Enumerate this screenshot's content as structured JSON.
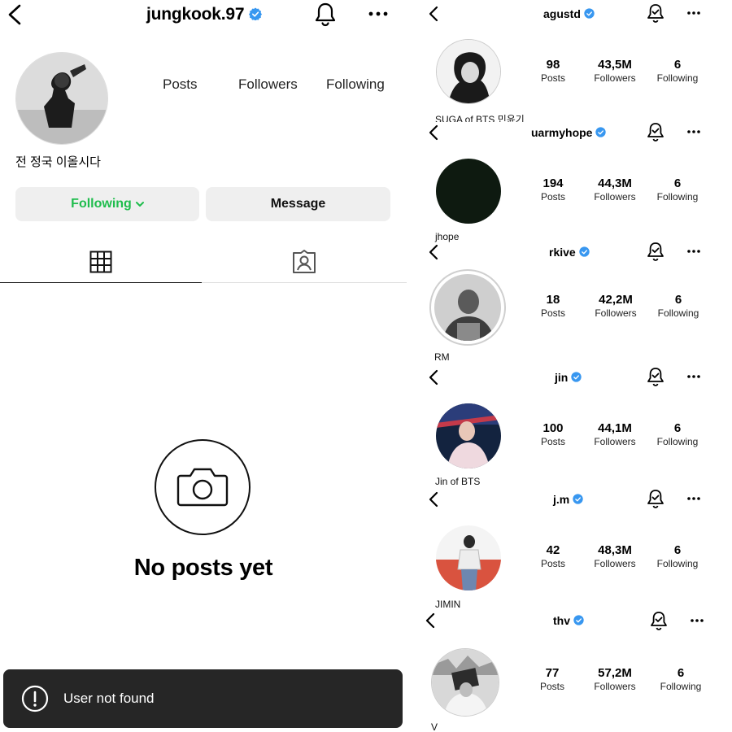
{
  "left_profile": {
    "username": "jungkook.97",
    "stats": {
      "posts_label": "Posts",
      "followers_label": "Followers",
      "following_label": "Following"
    },
    "bio": "전 정국 이올시다",
    "buttons": {
      "following_label": "Following",
      "message_label": "Message"
    },
    "empty_state": "No posts yet",
    "toast": "User not found",
    "colors": {
      "following_green": "#1fbd4d",
      "verified_blue": "#3897f0"
    }
  },
  "profiles": [
    {
      "username": "agustd",
      "posts": "98",
      "followers": "43,5M",
      "following": "6",
      "display_name": "SUGA of BTS 민윤기",
      "posts_label": "Posts",
      "followers_label": "Followers",
      "following_label": "Following"
    },
    {
      "username": "uarmyhope",
      "posts": "194",
      "followers": "44,3M",
      "following": "6",
      "display_name": "jhope",
      "posts_label": "Posts",
      "followers_label": "Followers",
      "following_label": "Following"
    },
    {
      "username": "rkive",
      "posts": "18",
      "followers": "42,2M",
      "following": "6",
      "display_name": "RM",
      "posts_label": "Posts",
      "followers_label": "Followers",
      "following_label": "Following"
    },
    {
      "username": "jin",
      "posts": "100",
      "followers": "44,1M",
      "following": "6",
      "display_name": "Jin of BTS",
      "posts_label": "Posts",
      "followers_label": "Followers",
      "following_label": "Following"
    },
    {
      "username": "j.m",
      "posts": "42",
      "followers": "48,3M",
      "following": "6",
      "display_name": "JIMIN",
      "posts_label": "Posts",
      "followers_label": "Followers",
      "following_label": "Following"
    },
    {
      "username": "thv",
      "posts": "77",
      "followers": "57,2M",
      "following": "6",
      "display_name": "V",
      "posts_label": "Posts",
      "followers_label": "Followers",
      "following_label": "Following"
    }
  ],
  "icons": [
    "back-arrow-icon",
    "verified-badge-icon",
    "bell-icon",
    "bell-check-icon",
    "more-options-icon",
    "chevron-down-icon",
    "grid-icon",
    "tagged-icon",
    "camera-icon",
    "alert-icon"
  ]
}
